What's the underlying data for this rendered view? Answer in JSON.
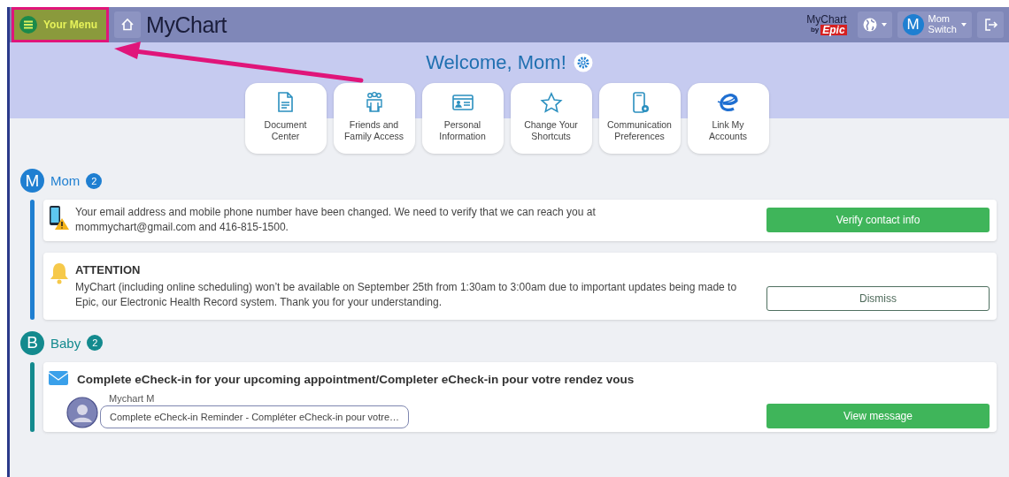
{
  "header": {
    "menu_button": {
      "label": "Your Menu",
      "highlighted": true
    },
    "logo": "MyChart",
    "epic_logo": {
      "name": "MyChart",
      "by": "by",
      "brand": "Epic"
    },
    "user": {
      "initial": "M",
      "name": "Mom",
      "action": "Switch"
    }
  },
  "welcome": {
    "title": "Welcome, Mom!",
    "shortcuts": [
      {
        "label": "Document Center"
      },
      {
        "label": "Friends and Family Access"
      },
      {
        "label": "Personal Information"
      },
      {
        "label": "Change Your Shortcuts"
      },
      {
        "label": "Communication Preferences"
      },
      {
        "label": "Link My Accounts"
      }
    ]
  },
  "sections": [
    {
      "initial": "M",
      "name": "Mom",
      "count": "2",
      "color": "#1f7fd1",
      "items": [
        {
          "kind": "alert",
          "text": "Your email address and mobile phone number have been changed. We need to verify that we can reach you at mommychart@gmail.com and 416-815-1500.",
          "button": {
            "label": "Verify contact info",
            "kind": "primary"
          }
        },
        {
          "kind": "notice",
          "title": "ATTENTION",
          "text": "MyChart (including online scheduling) won’t be available on September 25th from 1:30am to 3:00am due to important updates being made to Epic, our Electronic Health Record system. Thank you for your understanding.",
          "button": {
            "label": "Dismiss",
            "kind": "outline"
          }
        }
      ]
    },
    {
      "initial": "B",
      "name": "Baby",
      "count": "2",
      "color": "#138a8e",
      "items": [
        {
          "kind": "message",
          "title": "Complete eCheck-in for your upcoming appointment/Completer eCheck-in pour votre rendez vous",
          "sender": "Mychart M",
          "preview": "Complete eCheck-in Reminder - Compléter eCheck-in pour votre…",
          "button": {
            "label": "View message",
            "kind": "primary"
          }
        }
      ]
    }
  ]
}
